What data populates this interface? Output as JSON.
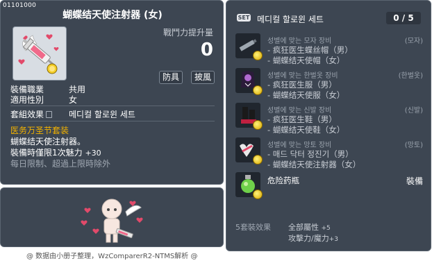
{
  "item": {
    "id": "01101000",
    "name": "蝴蝶结天使注射器 (女)",
    "power_label": "戰鬥力提升量",
    "power_value": "0",
    "tags": [
      "防具",
      "披風"
    ],
    "job_key": "裝備職業",
    "job_value": "共用",
    "gender_key": "適用性別",
    "gender_value": "女",
    "set_key": "套組效果",
    "set_value": "메디컬 할로윈 세트",
    "desc_title": "医务万圣节套装",
    "desc_line1": "蝴蝶结天使注射器。",
    "desc_line2": "裝備時僅限1次魅力",
    "desc_line2_bonus": "+30",
    "desc_line3": "每日限制、超過上限時除外",
    "colors": {
      "accent": "#f2b200",
      "panel": "#3d4652"
    }
  },
  "set": {
    "badge": "SET",
    "name": "메디컬 할로윈 세트",
    "count": "0 / 5",
    "rows": [
      {
        "line1": "성별에 맞는 모자 장비",
        "cat": "(모자)",
        "line_a": "- 疯狂医生蝶丝帽（男）",
        "line_b": "- 蝴蝶结天使帽（女）",
        "icon": "hat-icon"
      },
      {
        "line1": "성별에 맞는 한벌옷 장비",
        "cat": "(한벌옷)",
        "line_a": "- 疯狂医生服（男）",
        "line_b": "- 蝴蝶结天使服（女）",
        "icon": "outfit-icon"
      },
      {
        "line1": "성별에 맞는 신발 장비",
        "cat": "(신발)",
        "line_a": "- 疯狂医生鞋（男）",
        "line_b": "- 蝴蝶结天使鞋（女）",
        "icon": "shoes-icon"
      },
      {
        "line1": "성별에 맞는 망토 장비",
        "cat": "(망토)",
        "line_a": "- 매드 닥터 정진기（男）",
        "line_b": "- 蝴蝶结天使注射器（女）",
        "icon": "cape-icon"
      }
    ],
    "extra": {
      "name": "危险药瓶",
      "status": "裝備",
      "icon": "potion-icon"
    },
    "bonus_label": "5套裝效果",
    "bonus_line1": "全部屬性",
    "bonus_line1_val": "+5",
    "bonus_line2": "攻擊力/魔力",
    "bonus_line2_val": "+3"
  },
  "footer": "@ 数据由小册子整理，WzComparerR2-NTMS解析 @"
}
